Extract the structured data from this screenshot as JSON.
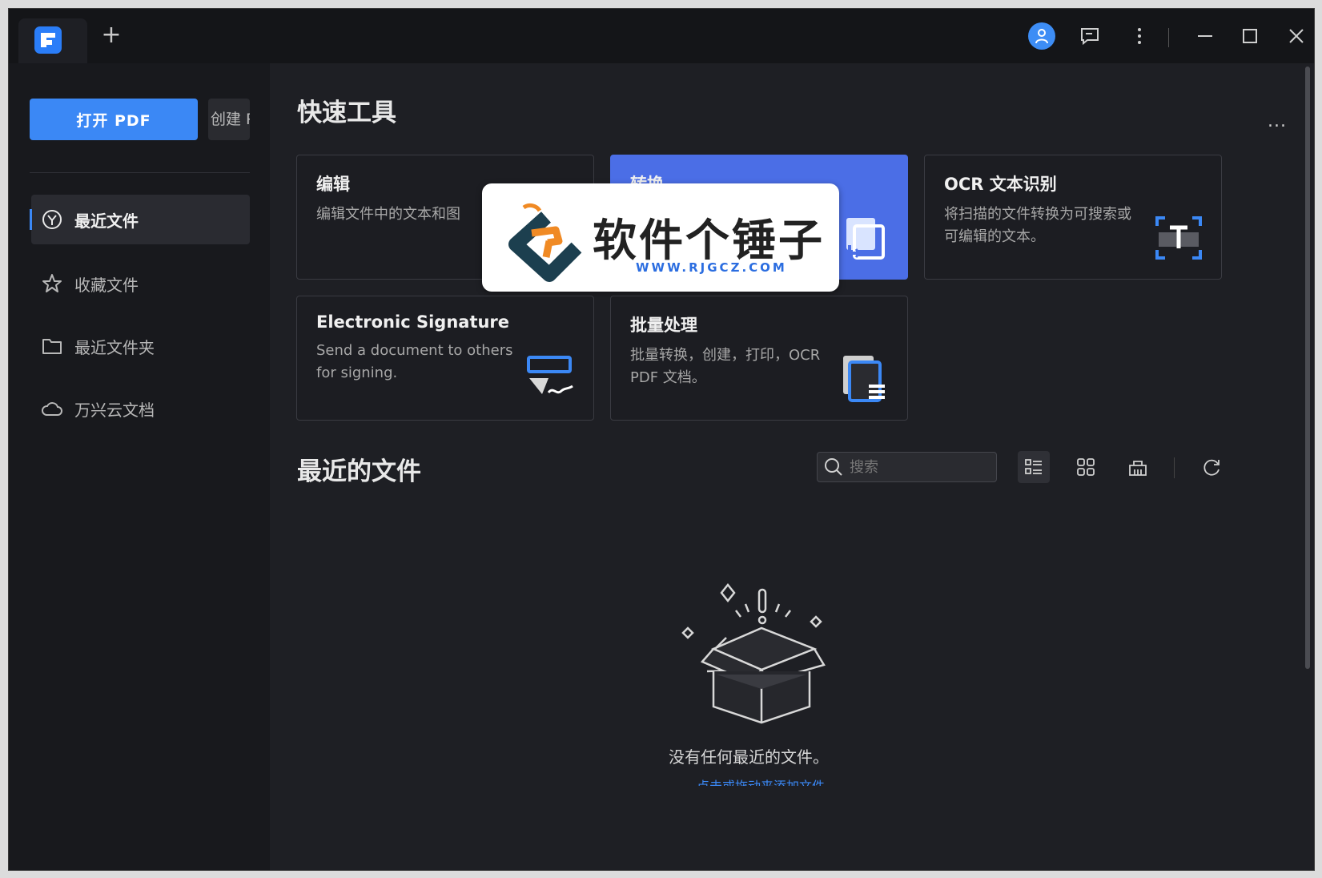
{
  "titlebar": {
    "new_tab": "+"
  },
  "sidebar": {
    "open_pdf": "打开 PDF",
    "create": "创建 PDF",
    "items": [
      {
        "label": "最近文件",
        "icon": "clock-icon",
        "active": true
      },
      {
        "label": "收藏文件",
        "icon": "star-icon",
        "active": false
      },
      {
        "label": "最近文件夹",
        "icon": "folder-icon",
        "active": false
      },
      {
        "label": "万兴云文档",
        "icon": "cloud-icon",
        "active": false
      }
    ]
  },
  "quick_tools": {
    "title": "快速工具",
    "more": "...",
    "cards": [
      {
        "title": "编辑",
        "desc": "编辑文件中的文本和图"
      },
      {
        "title": "转换",
        "desc": ""
      },
      {
        "title": "OCR 文本识别",
        "desc": "将扫描的文件转换为可搜索或可编辑的文本。"
      },
      {
        "title": "Electronic Signature",
        "desc": "Send a document to others for signing."
      },
      {
        "title": "批量处理",
        "desc": "批量转换，创建，打印，OCR PDF 文档。"
      }
    ]
  },
  "watermark": {
    "text": "软件个锤子",
    "url": "WWW.RJGCZ.COM"
  },
  "recent": {
    "title": "最近的文件",
    "search_placeholder": "搜索",
    "empty_text": "没有任何最近的文件。",
    "empty_link": "点击或拖动来添加文件"
  },
  "colors": {
    "accent": "#3b88f5",
    "background": "#1e1f24",
    "sidebar": "#18191d",
    "card_blue": "#4b6ee6"
  }
}
